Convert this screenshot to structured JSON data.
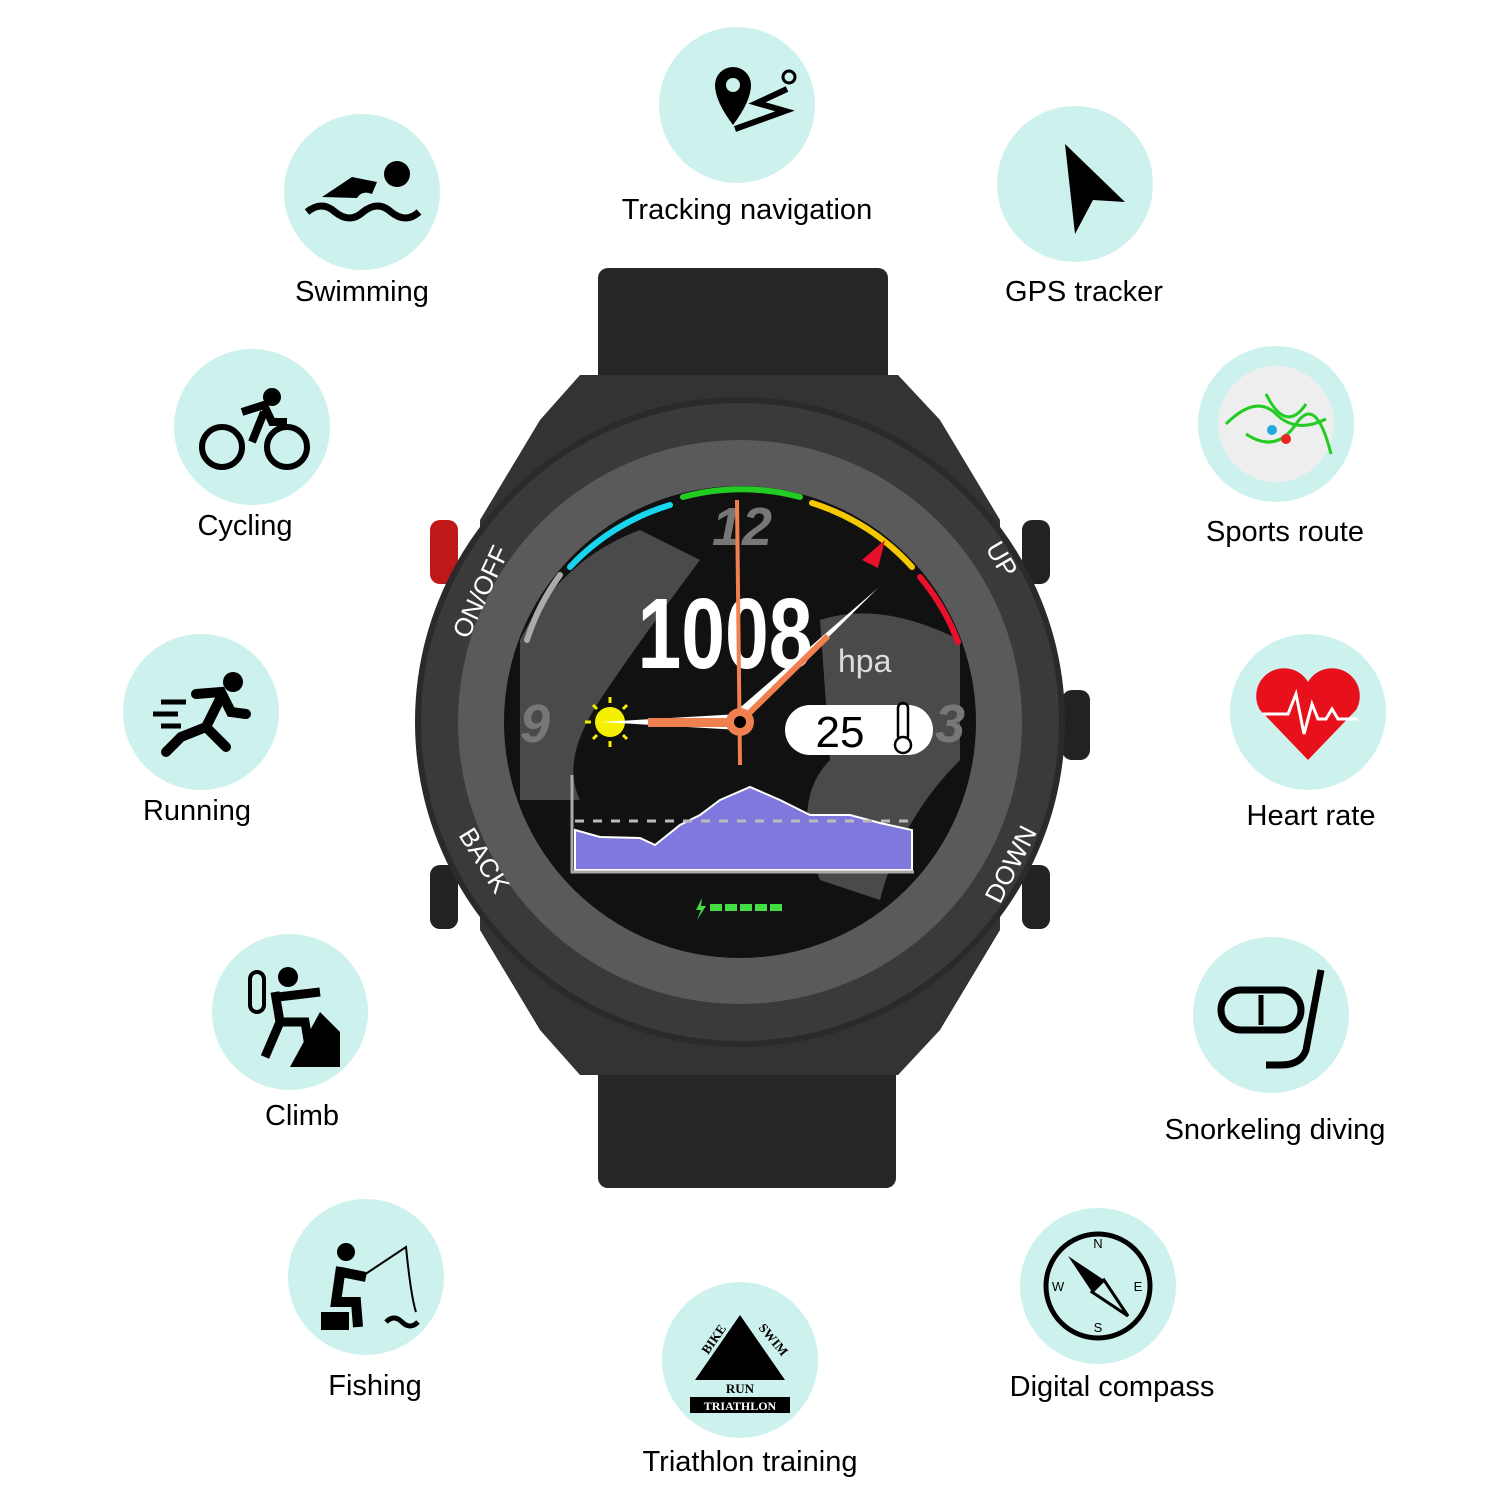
{
  "features": [
    {
      "label": "Tracking navigation",
      "icon": "route-pin-icon"
    },
    {
      "label": "Swimming",
      "icon": "swimmer-icon"
    },
    {
      "label": "GPS tracker",
      "icon": "navigation-arrow-icon"
    },
    {
      "label": "Cycling",
      "icon": "cyclist-icon"
    },
    {
      "label": "Sports route",
      "icon": "route-map-icon"
    },
    {
      "label": "Running",
      "icon": "runner-icon"
    },
    {
      "label": "Heart rate",
      "icon": "heart-pulse-icon"
    },
    {
      "label": "Climb",
      "icon": "climber-icon"
    },
    {
      "label": "Snorkeling diving",
      "icon": "snorkel-mask-icon"
    },
    {
      "label": "Fishing",
      "icon": "fisherman-icon"
    },
    {
      "label": "Digital compass",
      "icon": "compass-icon"
    },
    {
      "label": "Triathlon training",
      "icon": "triathlon-badge-icon"
    }
  ],
  "triathlon_badge": {
    "bike": "BIKE",
    "swim": "SWIM",
    "run": "RUN",
    "title": "TRIATHLON"
  },
  "compass": {
    "n": "N",
    "e": "E",
    "s": "S",
    "w": "W"
  },
  "watch": {
    "buttons": {
      "on_off": "ON/OFF",
      "up": "UP",
      "back": "BACK",
      "down": "DOWN"
    },
    "face": {
      "pressure": "1008",
      "pressure_unit": "hpa",
      "temperature": "25",
      "hour_12": "12",
      "hour_9": "9",
      "hour_3": "3",
      "battery_segments": 5
    },
    "colors": {
      "hands": "#f08050",
      "graph": "#8079dd",
      "arc_cyan": "#19d6f0",
      "arc_green": "#22cc22",
      "arc_yellow": "#f5c800",
      "arc_red": "#e8102a",
      "battery": "#44dd44"
    }
  }
}
